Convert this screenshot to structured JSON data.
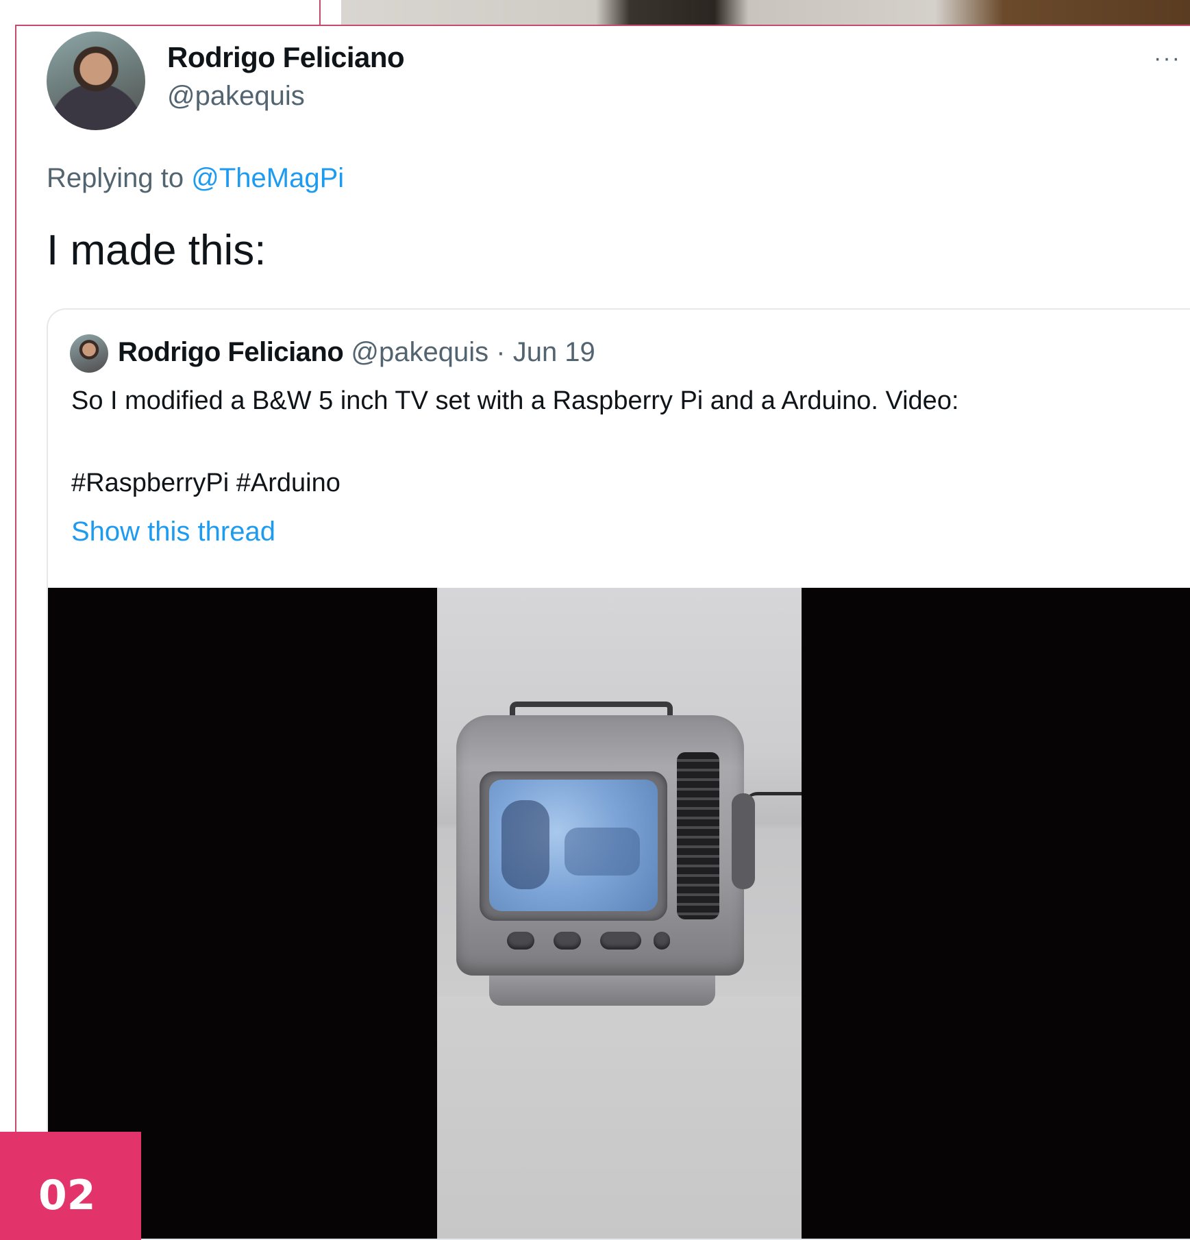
{
  "tweet": {
    "display_name": "Rodrigo Feliciano",
    "handle": "@pakequis",
    "more_label": "···",
    "replying_prefix": "Replying to",
    "replying_mention": "@TheMagPi",
    "text": "I made this:"
  },
  "quote": {
    "display_name": "Rodrigo Feliciano",
    "meta": "@pakequis · Jun 19",
    "body": "So I modified a B&W 5 inch TV set with a Raspberry Pi and a Arduino.  Video:",
    "hashtags": "#RaspberryPi #Arduino",
    "show_thread": "Show this thread"
  },
  "badge": {
    "number": "02"
  },
  "colors": {
    "accent_link": "#1d9bf0",
    "badge": "#e2336a",
    "border": "#c74a6a"
  }
}
